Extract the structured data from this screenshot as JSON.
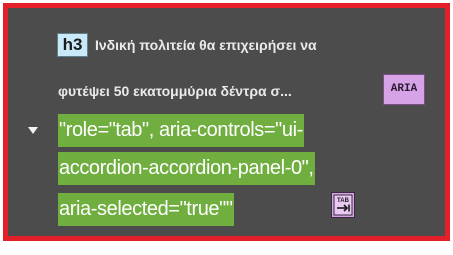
{
  "heading": {
    "badge": "h3",
    "line1": "Ινδική πολιτεία θα επιχειρήσει να",
    "line2": "φυτέψει 50 εκατομμύρια δέντρα σ...",
    "aria_badge": "ARIA"
  },
  "attributes": {
    "line1": "\"role=\"tab\", aria-controls=\"ui-",
    "line2": "accordion-accordion-panel-0\",",
    "line3": "aria-selected=\"true\"\""
  },
  "icons": {
    "expand": "chevron-down-icon",
    "keyboard": "tab-key-icon"
  },
  "colors": {
    "border": "#e3202a",
    "panel": "#4c4c4c",
    "attr_highlight": "#6fae3f",
    "h3_badge": "#c9e9f8",
    "aria_badge": "#d6a3e6"
  }
}
